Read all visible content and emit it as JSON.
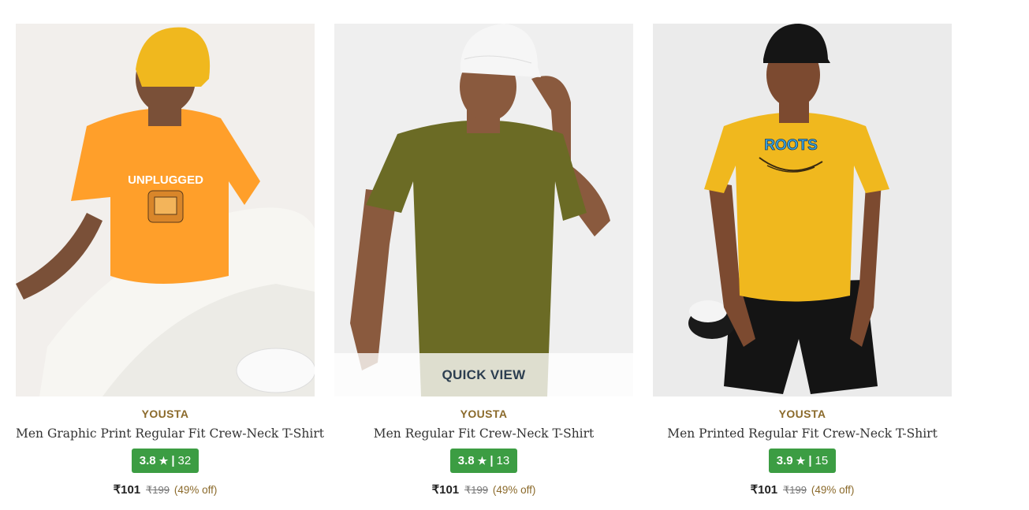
{
  "products": [
    {
      "brand": "YOUSTA",
      "name": "Men Graphic Print Regular Fit Crew-Neck T-Shirt",
      "rating": "3.8",
      "reviews": "32",
      "price": "₹101",
      "mrp": "₹199",
      "discount": "(49% off)",
      "shirt_text": "UNPLUGGED",
      "shirt_color": "#ff9f2a",
      "quick_view": ""
    },
    {
      "brand": "YOUSTA",
      "name": "Men Regular Fit Crew-Neck T-Shirt",
      "rating": "3.8",
      "reviews": "13",
      "price": "₹101",
      "mrp": "₹199",
      "discount": "(49% off)",
      "shirt_text": "",
      "shirt_color": "#6b6b25",
      "quick_view": "QUICK VIEW"
    },
    {
      "brand": "YOUSTA",
      "name": "Men Printed Regular Fit Crew-Neck T-Shirt",
      "rating": "3.9",
      "reviews": "15",
      "price": "₹101",
      "mrp": "₹199",
      "discount": "(49% off)",
      "shirt_text": "ROOTS",
      "shirt_color": "#f0b81e",
      "quick_view": ""
    }
  ],
  "rating_star": "★",
  "rating_separator": "|",
  "colors": {
    "rating_badge": "#3c9d43",
    "brand_text": "#8b6a2b"
  }
}
